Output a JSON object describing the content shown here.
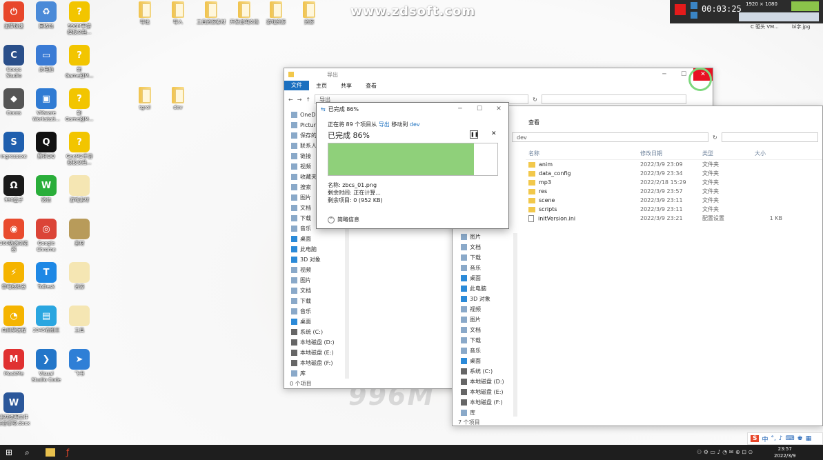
{
  "watermark": "www.zdsoft.com",
  "watermark_bottom": "996M",
  "recorder": {
    "resolution": "1920 × 1080",
    "timer": "00:03:25",
    "file_a": "C 驱头 VM...",
    "file_b": "bi字.jpg"
  },
  "desktop_icons": [
    {
      "label": "迅雷极速",
      "color": "#e8472b",
      "glyph": "⏻"
    },
    {
      "label": "回收站",
      "color": "#4a8ad8",
      "glyph": "♻"
    },
    {
      "label": "996M手游\n模板文档...",
      "color": "#f2c500",
      "glyph": "?"
    },
    {
      "label": "Cocos\nStudio",
      "color": "#2a4f8a",
      "glyph": "C"
    },
    {
      "label": "此电脑",
      "color": "#3a7bd5",
      "glyph": "▭"
    },
    {
      "label": "新\nGame创M...",
      "color": "#f2c500",
      "glyph": "?"
    },
    {
      "label": "Cocos",
      "color": "#555",
      "glyph": "◆"
    },
    {
      "label": "VMware\nWorkstati...",
      "color": "#2f7bd3",
      "glyph": "▣"
    },
    {
      "label": "新\nGame创M...",
      "color": "#f2c500",
      "glyph": "?"
    },
    {
      "label": "Ingressexe",
      "color": "#1f5fae",
      "glyph": "S"
    },
    {
      "label": "腾讯QQ",
      "color": "#111",
      "glyph": "Q"
    },
    {
      "label": "GeeM2手游\n模板文档...",
      "color": "#f2c500",
      "glyph": "?"
    },
    {
      "label": "990盒子",
      "color": "#1a1a1a",
      "glyph": "Ω"
    },
    {
      "label": "微信",
      "color": "#2aae3a",
      "glyph": "W"
    },
    {
      "label": "游戏素材",
      "color": "#f5e6b3",
      "glyph": ""
    },
    {
      "label": "360极速浏览\n器",
      "color": "#e94b2e",
      "glyph": "◉"
    },
    {
      "label": "Google\nChrome",
      "color": "#db4437",
      "glyph": "◎"
    },
    {
      "label": "素材",
      "color": "#b89b5a",
      "glyph": ""
    },
    {
      "label": "雷电模拟器",
      "color": "#f5b400",
      "glyph": "⚡"
    },
    {
      "label": "ToDesk",
      "color": "#1e88e5",
      "glyph": "T"
    },
    {
      "label": "资源",
      "color": "#f5e6b3",
      "glyph": ""
    },
    {
      "label": "向日葵远程",
      "color": "#f5b400",
      "glyph": "◔"
    },
    {
      "label": "2345看图王",
      "color": "#2aa6e0",
      "glyph": "▤"
    },
    {
      "label": "工具",
      "color": "#f5e6b3",
      "glyph": ""
    },
    {
      "label": "MockMe",
      "color": "#e03131",
      "glyph": "M"
    },
    {
      "label": "Visual\nStudio Code",
      "color": "#2376c9",
      "glyph": "❯"
    },
    {
      "label": "飞书",
      "color": "#2f7fd6",
      "glyph": "➤"
    },
    {
      "label": "素材说明文件\n注意事项.docx",
      "color": "#2b579a",
      "glyph": "W"
    }
  ],
  "top_folders": [
    "导出",
    "导入",
    "工具资源素材",
    "开发说明文档",
    "游戏资源",
    "资源"
  ],
  "mid_folders": [
    "tgrol",
    "dev"
  ],
  "win1": {
    "title": "导出",
    "tabs": [
      "文件",
      "主页",
      "共享",
      "查看"
    ],
    "addr": "导出",
    "nav": [
      "OneDrive",
      "Pictures",
      "保存的图片",
      "联系人",
      "链接",
      "视频",
      "收藏夹",
      "搜索",
      "图片",
      "文档",
      "下载",
      "音乐",
      "桌面",
      "此电脑",
      "3D 对象",
      "视频",
      "图片",
      "文档",
      "下载",
      "音乐",
      "桌面",
      "系统 (C:)",
      "本地磁盘 (D:)",
      "本地磁盘 (E:)",
      "本地磁盘 (F:)",
      "库"
    ],
    "status": "0 个项目"
  },
  "win2": {
    "tab": "查看",
    "addr": "dev",
    "columns": [
      "名称",
      "修改日期",
      "类型",
      "大小"
    ],
    "files": [
      {
        "name": "anim",
        "date": "2022/3/9 23:09",
        "type": "文件夹",
        "size": ""
      },
      {
        "name": "data_config",
        "date": "2022/3/9 23:34",
        "type": "文件夹",
        "size": ""
      },
      {
        "name": "mp3",
        "date": "2022/2/18 15:29",
        "type": "文件夹",
        "size": ""
      },
      {
        "name": "res",
        "date": "2022/3/9 23:57",
        "type": "文件夹",
        "size": ""
      },
      {
        "name": "scene",
        "date": "2022/3/9 23:11",
        "type": "文件夹",
        "size": ""
      },
      {
        "name": "scripts",
        "date": "2022/3/9 23:11",
        "type": "文件夹",
        "size": ""
      },
      {
        "name": "initVersion.ini",
        "date": "2022/3/9 23:21",
        "type": "配置设置",
        "size": "1 KB"
      }
    ],
    "nav": [
      "图片",
      "文档",
      "下载",
      "音乐",
      "桌面",
      "此电脑",
      "3D 对象",
      "视频",
      "图片",
      "文档",
      "下载",
      "音乐",
      "桌面",
      "系统 (C:)",
      "本地磁盘 (D:)",
      "本地磁盘 (E:)",
      "本地磁盘 (F:)",
      "库"
    ],
    "status": "7 个项目"
  },
  "progress": {
    "title": "已完成 86%",
    "line_prefix": "正在将 89 个项目从",
    "from": "导出",
    "mid": "移动到",
    "to": "dev",
    "heading": "已完成 86%",
    "percent": 0.86,
    "name_label": "名称: zbcs_01.png",
    "time_label": "剩余时间: 正在计算...",
    "items_label": "剩余项目: 0 (952 KB)",
    "less_info": "简略信息"
  },
  "clock": {
    "time": "23:57",
    "date": "2022/3/9"
  },
  "tray_lang": "中"
}
